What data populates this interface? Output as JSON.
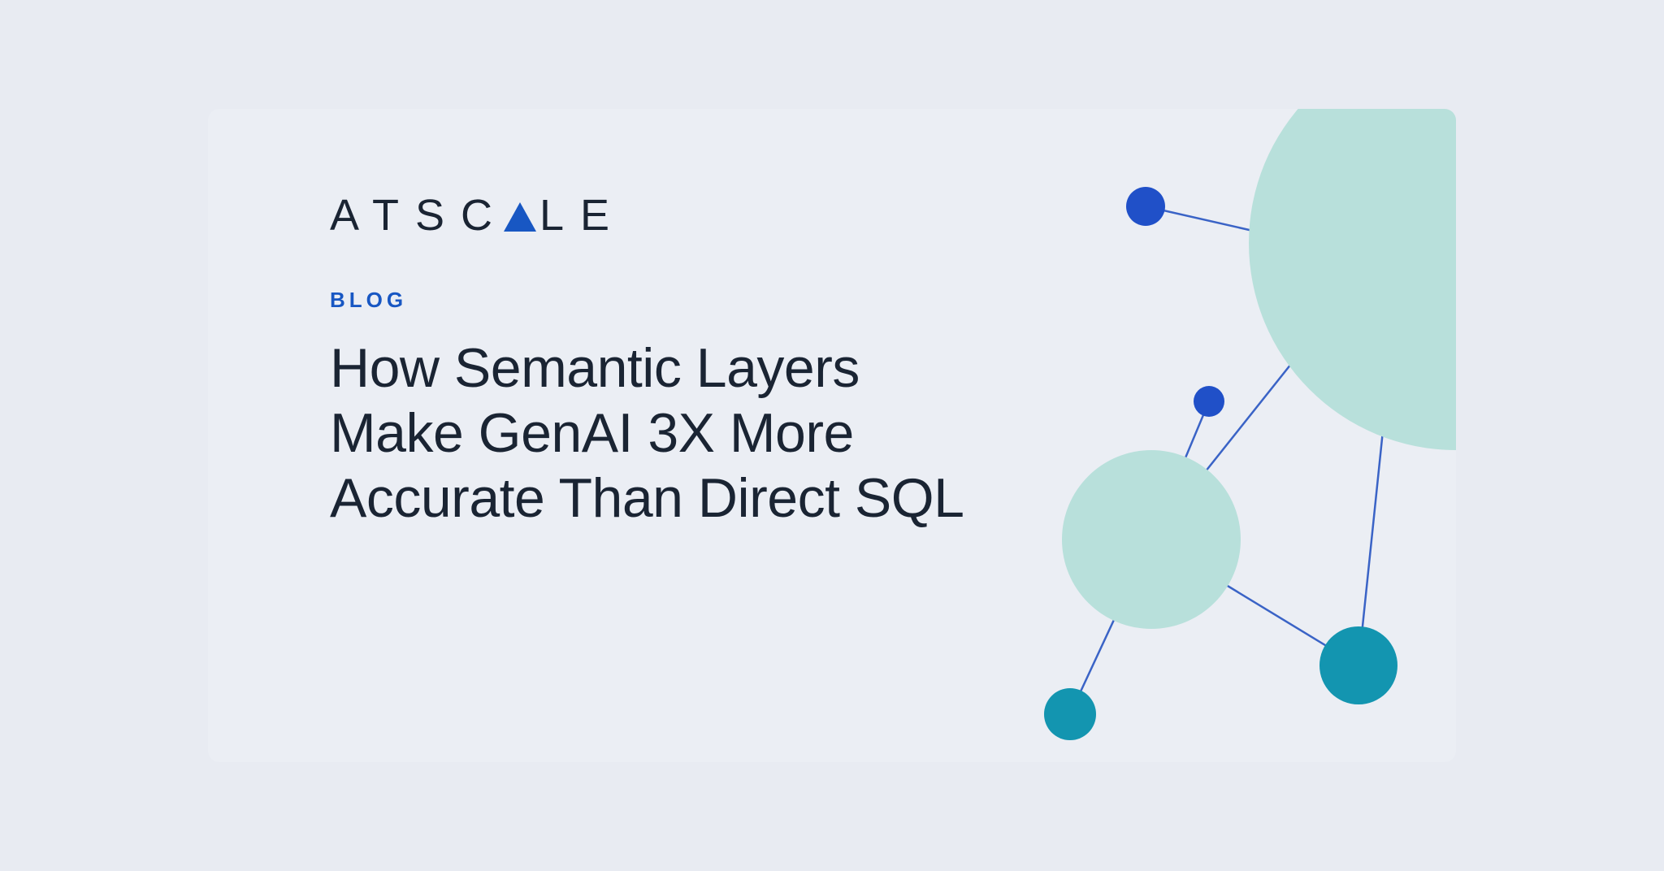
{
  "brand": {
    "name_left": "ATSC",
    "name_right": "LE"
  },
  "category": "BLOG",
  "title": "How Semantic Layers Make GenAI 3X More Accurate Than Direct SQL",
  "colors": {
    "background": "#e8ebf2",
    "card": "#ebeef4",
    "text_dark": "#1a2433",
    "accent_blue": "#1857c3",
    "node_teal_light": "#b8e0db",
    "node_teal_dark": "#1395b0",
    "node_blue_small": "#2050c8",
    "edge": "#3a63c6"
  },
  "graphic": {
    "nodes": [
      {
        "id": "big-circle",
        "shape": "circle",
        "color": "node_teal_light"
      },
      {
        "id": "mid-circle",
        "shape": "circle",
        "color": "node_teal_light"
      },
      {
        "id": "small-top",
        "shape": "circle",
        "color": "node_blue_small"
      },
      {
        "id": "small-mid",
        "shape": "circle",
        "color": "node_blue_small"
      },
      {
        "id": "bottom-left",
        "shape": "circle",
        "color": "node_teal_dark"
      },
      {
        "id": "bottom-right",
        "shape": "circle",
        "color": "node_teal_dark"
      }
    ],
    "edges": [
      [
        "small-top",
        "big-circle"
      ],
      [
        "big-circle",
        "mid-circle"
      ],
      [
        "big-circle",
        "bottom-right"
      ],
      [
        "mid-circle",
        "small-mid"
      ],
      [
        "mid-circle",
        "bottom-left"
      ],
      [
        "mid-circle",
        "bottom-right"
      ]
    ]
  }
}
